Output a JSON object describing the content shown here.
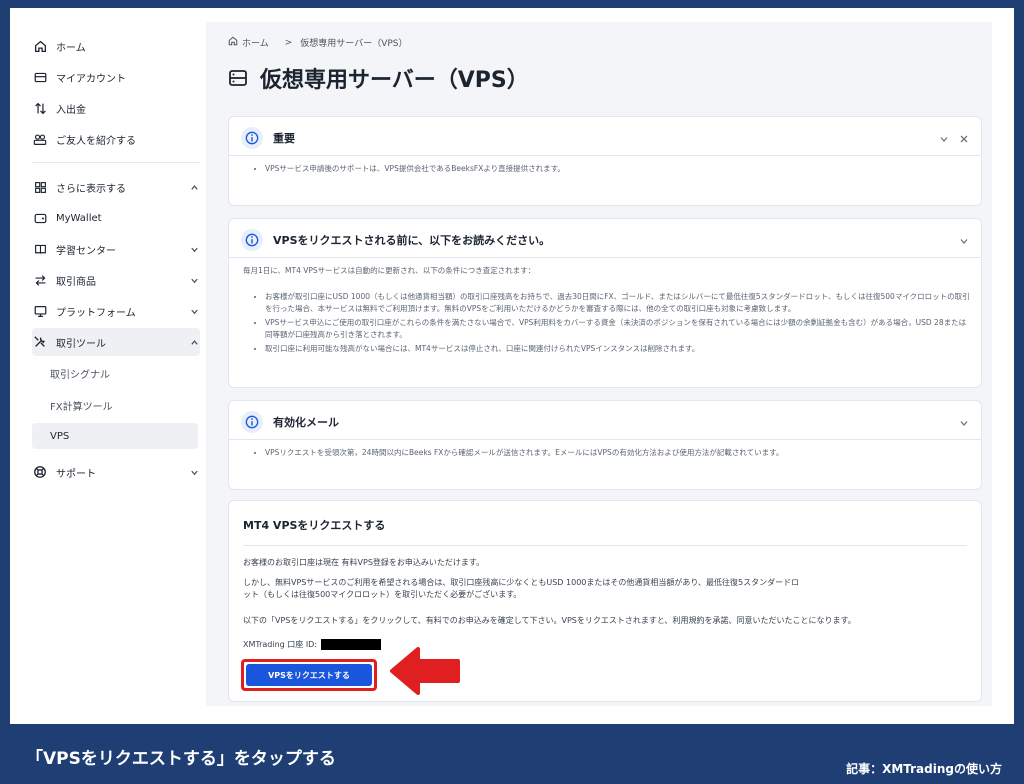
{
  "sidebar": {
    "items": [
      {
        "label": "ホーム",
        "icon": "home-icon"
      },
      {
        "label": "マイアカウント",
        "icon": "card-icon"
      },
      {
        "label": "入出金",
        "icon": "transfer-icon"
      },
      {
        "label": "ご友人を紹介する",
        "icon": "people-icon"
      },
      {
        "label": "さらに表示する",
        "icon": "grid-icon"
      },
      {
        "label": "MyWallet",
        "icon": "wallet-icon"
      },
      {
        "label": "学習センター",
        "icon": "book-icon"
      },
      {
        "label": "取引商品",
        "icon": "swap-icon"
      },
      {
        "label": "プラットフォーム",
        "icon": "monitor-icon"
      },
      {
        "label": "取引ツール",
        "icon": "tools-icon"
      },
      {
        "label": "サポート",
        "icon": "lifebuoy-icon"
      }
    ],
    "sub_items": [
      "取引シグナル",
      "FX計算ツール",
      "VPS"
    ]
  },
  "main": {
    "breadcrumb": {
      "home": "ホーム",
      "separator": ">",
      "current": "仮想専用サーバー（VPS）"
    },
    "title": "仮想専用サーバー（VPS）",
    "cards": {
      "important": {
        "title": "重要",
        "bullets": [
          "VPSサービス申請後のサポートは、VPS提供会社であるBeeksFXより直接提供されます。"
        ]
      },
      "before": {
        "title": "VPSをリクエストされる前に、以下をお読みください。",
        "intro": "毎月1日に、MT4 VPSサービスは自動的に更新され、以下の条件につき査定されます：",
        "bullets": [
          "お客様が取引口座にUSD 1000（もしくは他通貨相当額）の取引口座残高をお持ちで、過去30日間にFX、ゴールド、またはシルバーにて最低往復5スタンダードロット、もしくは往復500マイクロロットの取引を行った場合、本サービスは無料でご利用頂けます。無料のVPSをご利用いただけるかどうかを審査する際には、他の全ての取引口座も対象に考慮致します。",
          "VPSサービス申込にご使用の取引口座がこれらの条件を満たさない場合で、VPS利用料をカバーする資金（未決済のポジションを保有されている場合には少額の余剰証拠金も含む）がある場合，USD 28または同等額が口座残高から引き落とされます。",
          "取引口座に利用可能な残高がない場合には、MT4サービスは停止され、口座に関連付けられたVPSインスタンスは削除されます。"
        ]
      },
      "activation": {
        "title": "有効化メール",
        "bullets": [
          "VPSリクエストを受領次第，24時間以内にBeeks FXから確認メールが送信されます。EメールにはVPSの有効化方法および使用方法が記載されています。"
        ]
      },
      "request": {
        "title": "MT4 VPSをリクエストする",
        "p1": "お客様のお取引口座は現在 有料VPS登録をお申込みいただけます。",
        "p2": "しかし、無料VPSサービスのご利用を希望される場合は、取引口座残高に少なくともUSD 1000またはその他通貨相当額があり、最低往復5スタンダードロット（もしくは往復500マイクロロット）を取引いただく必要がございます。",
        "p3": "以下の「VPSをリクエストする」をクリックして、有料でのお申込みを確定して下さい。VPSをリクエストされますと、利用規約を承諾、同意いただいたことになります。",
        "account_label": "XMTrading 口座 ID:",
        "button": "VPSをリクエストする"
      }
    }
  },
  "caption": "「VPSをリクエストする」をタップする",
  "credit": "記事：XMTradingの使い方",
  "colors": {
    "frame": "#1f3e74",
    "accent": "#1a56db",
    "highlight": "#e02020"
  }
}
